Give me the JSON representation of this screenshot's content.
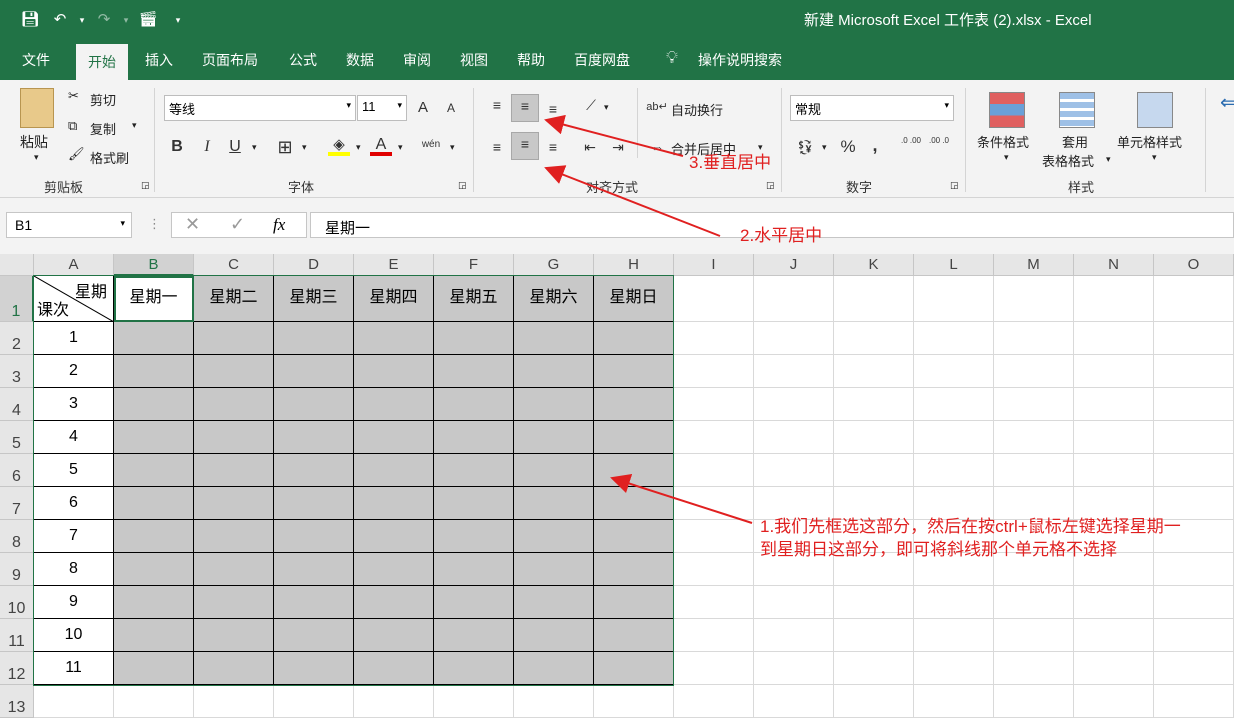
{
  "window": {
    "title": "新建 Microsoft Excel 工作表 (2).xlsx  -  Excel"
  },
  "tabs": [
    "文件",
    "开始",
    "插入",
    "页面布局",
    "公式",
    "数据",
    "审阅",
    "视图",
    "帮助",
    "百度网盘",
    "操作说明搜索"
  ],
  "clipboard": {
    "paste": "粘贴",
    "cut": "剪切",
    "copy": "复制",
    "format_painter": "格式刷",
    "label": "剪贴板"
  },
  "font": {
    "name": "等线",
    "size": "11",
    "label": "字体",
    "bold": "B",
    "italic": "I",
    "underline": "U",
    "grow": "A",
    "shrink": "A",
    "color_a": "A",
    "wen": "wén"
  },
  "alignment": {
    "wrap": "自动换行",
    "merge": "合并后居中",
    "label": "对齐方式"
  },
  "number": {
    "format": "常规",
    "percent": "%",
    "comma": ",",
    "inc": ".0 .00",
    "dec": ".00 .0",
    "label": "数字"
  },
  "styles": {
    "conditional": "条件格式",
    "table_1": "套用",
    "table_2": "表格格式",
    "cell": "单元格样式",
    "label": "样式"
  },
  "formula": {
    "namebox": "B1",
    "content": "星期一"
  },
  "columns": [
    "A",
    "B",
    "C",
    "D",
    "E",
    "F",
    "G",
    "H",
    "I",
    "J",
    "K",
    "L",
    "M",
    "N",
    "O"
  ],
  "rows": [
    "1",
    "2",
    "3",
    "4",
    "5",
    "6",
    "7",
    "8",
    "9",
    "10",
    "11",
    "12",
    "13"
  ],
  "header_cell": {
    "top": "星期",
    "bottom": "课次"
  },
  "weekdays": [
    "星期一",
    "星期二",
    "星期三",
    "星期四",
    "星期五",
    "星期六",
    "星期日"
  ],
  "lessons": [
    "1",
    "2",
    "3",
    "4",
    "5",
    "6",
    "7",
    "8",
    "9",
    "10",
    "11"
  ],
  "annotations": {
    "a1": "1.我们先框选这部分，然后在按ctrl+鼠标左键选择星期一",
    "a1b": "到星期日这部分，即可将斜线那个单元格不选择",
    "a2": "2.水平居中",
    "a3": "3.垂直居中"
  },
  "colors": {
    "excel_green": "#217346",
    "annotation_red": "#e02020",
    "selection_gray": "#c8c8c8"
  }
}
